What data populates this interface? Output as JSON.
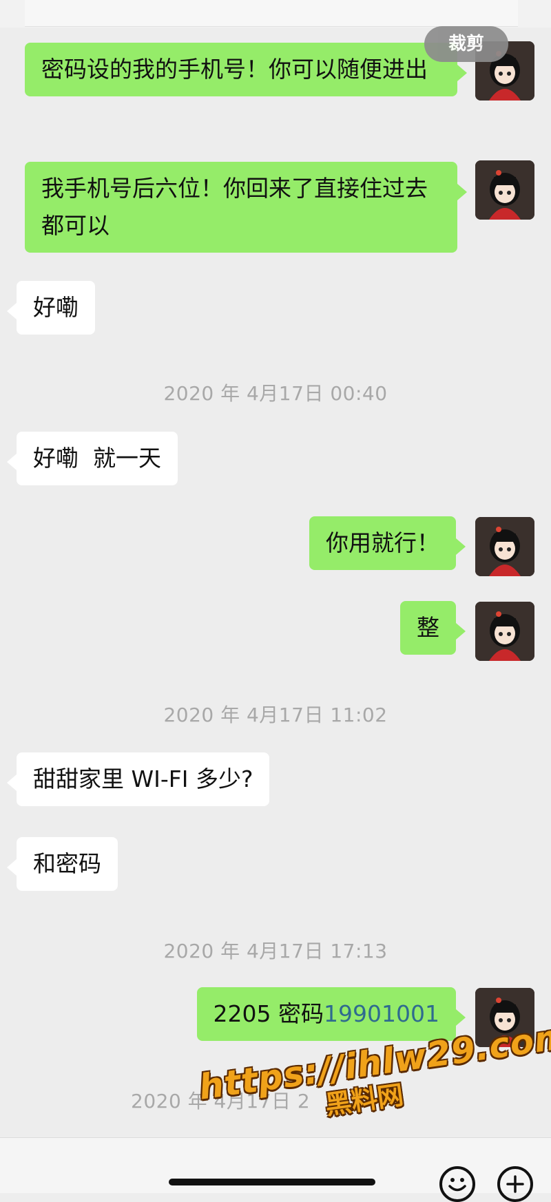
{
  "toolbar": {
    "crop_label": "裁剪"
  },
  "messages": [
    {
      "side": "me",
      "text": "密码设的我的手机号！你可以随便进出"
    },
    {
      "side": "me",
      "text": "我手机号后六位！你回来了直接住过去都可以"
    },
    {
      "side": "them",
      "text": "好嘞"
    },
    {
      "side": "them",
      "text": "好嘞  就一天"
    },
    {
      "side": "me",
      "text": "你用就行！"
    },
    {
      "side": "me",
      "text": "整"
    },
    {
      "side": "them",
      "text": "甜甜家里 WI-FI 多少?"
    },
    {
      "side": "them",
      "text": "和密码"
    },
    {
      "side": "me",
      "text_prefix": "2205 密码",
      "text_link": "19901001"
    }
  ],
  "timestamps": [
    "2020 年 4月17日 00:40",
    "2020 年 4月17日 11:02",
    "2020 年 4月17日 17:13",
    "2020 年 4月17日 2"
  ],
  "watermark": {
    "url": "https://ihlw29.com",
    "name": "黑料网"
  },
  "bottom": {
    "emoji_icon": "smiley-face-icon",
    "plus_icon": "plus-circle-icon"
  },
  "colors": {
    "my_bubble": "#95ec69",
    "their_bubble": "#ffffff",
    "background": "#ededed"
  }
}
